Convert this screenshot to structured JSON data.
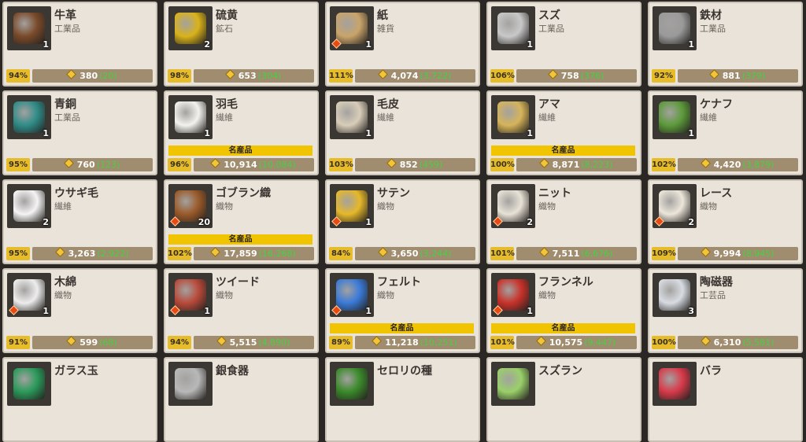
{
  "colors": {
    "background": "#2b2724",
    "card": "#e9e3da",
    "percent_badge": "#e6bc2a",
    "price_bar": "#a08c6e",
    "specialty_banner": "#f0c400",
    "green_text": "#42d43c"
  },
  "items": [
    {
      "name": "牛革",
      "category": "工業品",
      "qty": "1",
      "pct": "94%",
      "price": "380",
      "green": "(20)",
      "special": "",
      "diamond": false,
      "icon": "leather-hide-icon",
      "color": "#7a4a2a"
    },
    {
      "name": "硫黄",
      "category": "鉱石",
      "qty": "2",
      "pct": "98%",
      "price": "653",
      "green": "(304)",
      "special": "",
      "diamond": false,
      "icon": "sulfur-ore-icon",
      "color": "#d9b21a"
    },
    {
      "name": "紙",
      "category": "雑貨",
      "qty": "1",
      "pct": "111%",
      "price": "4,074",
      "green": "(3,722)",
      "special": "",
      "diamond": true,
      "icon": "paper-icon",
      "color": "#c9a46a"
    },
    {
      "name": "スズ",
      "category": "工業品",
      "qty": "1",
      "pct": "106%",
      "price": "758",
      "green": "(376)",
      "special": "",
      "diamond": false,
      "icon": "tin-ingot-icon",
      "color": "#c8c8c8"
    },
    {
      "name": "鉄材",
      "category": "工業品",
      "qty": "1",
      "pct": "92%",
      "price": "881",
      "green": "(379)",
      "special": "",
      "diamond": false,
      "icon": "iron-bar-icon",
      "color": "#9a9a9a"
    },
    {
      "name": "青銅",
      "category": "工業品",
      "qty": "1",
      "pct": "95%",
      "price": "760",
      "green": "(123)",
      "special": "",
      "diamond": false,
      "icon": "bronze-ingot-icon",
      "color": "#2f8c88"
    },
    {
      "name": "羽毛",
      "category": "繊維",
      "qty": "1",
      "pct": "96%",
      "price": "10,914",
      "green": "(10,084)",
      "special": "名産品",
      "diamond": false,
      "icon": "feather-icon",
      "color": "#f2f2ee"
    },
    {
      "name": "毛皮",
      "category": "繊維",
      "qty": "1",
      "pct": "103%",
      "price": "852",
      "green": "(459)",
      "special": "",
      "diamond": false,
      "icon": "fur-pelt-icon",
      "color": "#d8cdb8"
    },
    {
      "name": "アマ",
      "category": "繊維",
      "qty": "1",
      "pct": "100%",
      "price": "8,871",
      "green": "(8,223)",
      "special": "名産品",
      "diamond": false,
      "icon": "flax-icon",
      "color": "#d6b45a"
    },
    {
      "name": "ケナフ",
      "category": "繊維",
      "qty": "1",
      "pct": "102%",
      "price": "4,420",
      "green": "(3,879)",
      "special": "",
      "diamond": false,
      "icon": "kenaf-icon",
      "color": "#5c9a3a"
    },
    {
      "name": "ウサギ毛",
      "category": "繊維",
      "qty": "2",
      "pct": "95%",
      "price": "3,263",
      "green": "(2,922)",
      "special": "",
      "diamond": false,
      "icon": "rabbit-fur-icon",
      "color": "#f4f4f4"
    },
    {
      "name": "ゴブラン織",
      "category": "織物",
      "qty": "20",
      "pct": "102%",
      "price": "17,859",
      "green": "(16,268)",
      "special": "名産品",
      "diamond": true,
      "icon": "gobelin-cloth-icon",
      "color": "#9a5a2a"
    },
    {
      "name": "サテン",
      "category": "織物",
      "qty": "1",
      "pct": "84%",
      "price": "3,650",
      "green": "(3,244)",
      "special": "",
      "diamond": true,
      "icon": "satin-cloth-icon",
      "color": "#e6b82a"
    },
    {
      "name": "ニット",
      "category": "織物",
      "qty": "2",
      "pct": "101%",
      "price": "7,511",
      "green": "(6,676)",
      "special": "",
      "diamond": true,
      "icon": "knit-icon",
      "color": "#e8e2d6"
    },
    {
      "name": "レース",
      "category": "織物",
      "qty": "2",
      "pct": "109%",
      "price": "9,994",
      "green": "(8,945)",
      "special": "",
      "diamond": true,
      "icon": "lace-icon",
      "color": "#ece6da"
    },
    {
      "name": "木綿",
      "category": "織物",
      "qty": "1",
      "pct": "91%",
      "price": "599",
      "green": "(68)",
      "special": "",
      "diamond": true,
      "icon": "cotton-icon",
      "color": "#ededed"
    },
    {
      "name": "ツイード",
      "category": "織物",
      "qty": "1",
      "pct": "94%",
      "price": "5,515",
      "green": "(4,890)",
      "special": "",
      "diamond": true,
      "icon": "tweed-icon",
      "color": "#b84a3a"
    },
    {
      "name": "フェルト",
      "category": "織物",
      "qty": "1",
      "pct": "89%",
      "price": "11,218",
      "green": "(10,251)",
      "special": "名産品",
      "diamond": true,
      "icon": "felt-icon",
      "color": "#3a7ad8"
    },
    {
      "name": "フランネル",
      "category": "織物",
      "qty": "1",
      "pct": "101%",
      "price": "10,575",
      "green": "(9,447)",
      "special": "名産品",
      "diamond": true,
      "icon": "flannel-icon",
      "color": "#c8322a"
    },
    {
      "name": "陶磁器",
      "category": "工芸品",
      "qty": "3",
      "pct": "100%",
      "price": "6,310",
      "green": "(5,581)",
      "special": "",
      "diamond": false,
      "icon": "teapot-icon",
      "color": "#d8dce2"
    },
    {
      "name": "ガラス玉",
      "category": "",
      "qty": "",
      "pct": "",
      "price": "",
      "green": "",
      "special": "",
      "diamond": false,
      "icon": "glass-bead-icon",
      "color": "#2a9a5a"
    },
    {
      "name": "銀食器",
      "category": "",
      "qty": "",
      "pct": "",
      "price": "",
      "green": "",
      "special": "",
      "diamond": false,
      "icon": "silverware-icon",
      "color": "#b8b8b8"
    },
    {
      "name": "セロリの種",
      "category": "",
      "qty": "",
      "pct": "",
      "price": "",
      "green": "",
      "special": "",
      "diamond": false,
      "icon": "celery-seed-icon",
      "color": "#3a8a2a"
    },
    {
      "name": "スズラン",
      "category": "",
      "qty": "",
      "pct": "",
      "price": "",
      "green": "",
      "special": "",
      "diamond": false,
      "icon": "lily-of-valley-icon",
      "color": "#9ad06a"
    },
    {
      "name": "バラ",
      "category": "",
      "qty": "",
      "pct": "",
      "price": "",
      "green": "",
      "special": "",
      "diamond": false,
      "icon": "rose-icon",
      "color": "#d83a4a"
    }
  ]
}
